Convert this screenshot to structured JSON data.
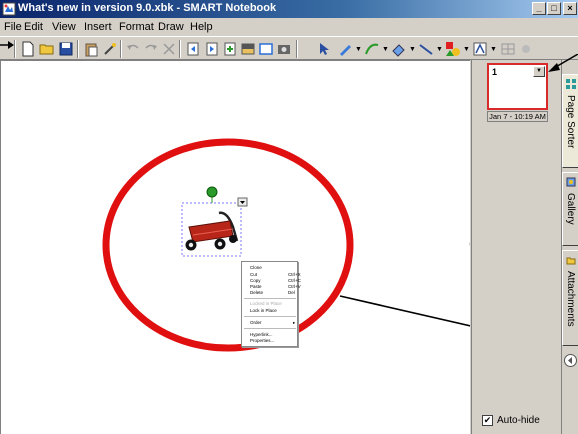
{
  "window": {
    "title": "What's new in version 9.0.xbk - SMART Notebook"
  },
  "menubar": {
    "items": [
      "File",
      "Edit",
      "View",
      "Insert",
      "Format",
      "Draw",
      "Help"
    ]
  },
  "context_menu": {
    "items": [
      {
        "label": "Clone",
        "shortcut": "",
        "disabled": false
      },
      {
        "label": "Cut",
        "shortcut": "Ctrl+X",
        "disabled": false
      },
      {
        "label": "Copy",
        "shortcut": "Ctrl+C",
        "disabled": false
      },
      {
        "label": "Paste",
        "shortcut": "Ctrl+V",
        "disabled": false
      },
      {
        "label": "Delete",
        "shortcut": "Del",
        "disabled": false
      },
      {
        "label": "Locked in Place",
        "shortcut": "",
        "disabled": true
      },
      {
        "label": "Lock in Place",
        "shortcut": "",
        "disabled": false
      },
      {
        "label": "Order",
        "shortcut": "▸",
        "disabled": false
      },
      {
        "label": "Hyperlink...",
        "shortcut": "",
        "disabled": false
      },
      {
        "label": "Properties...",
        "shortcut": "",
        "disabled": false
      }
    ]
  },
  "page_sorter": {
    "page_number": "1",
    "thumbnail_date": "Jan 7 - 10:19 AM",
    "autohide_label": "Auto-hide",
    "autohide_checked": "✔"
  },
  "tabs": {
    "page_sorter": "Page Sorter",
    "gallery": "Gallery",
    "attachments": "Attachments"
  },
  "colors": {
    "title_bar": "#0a246a",
    "annotation_circle": "#e01010",
    "thumbnail_border": "#d82a2a"
  }
}
